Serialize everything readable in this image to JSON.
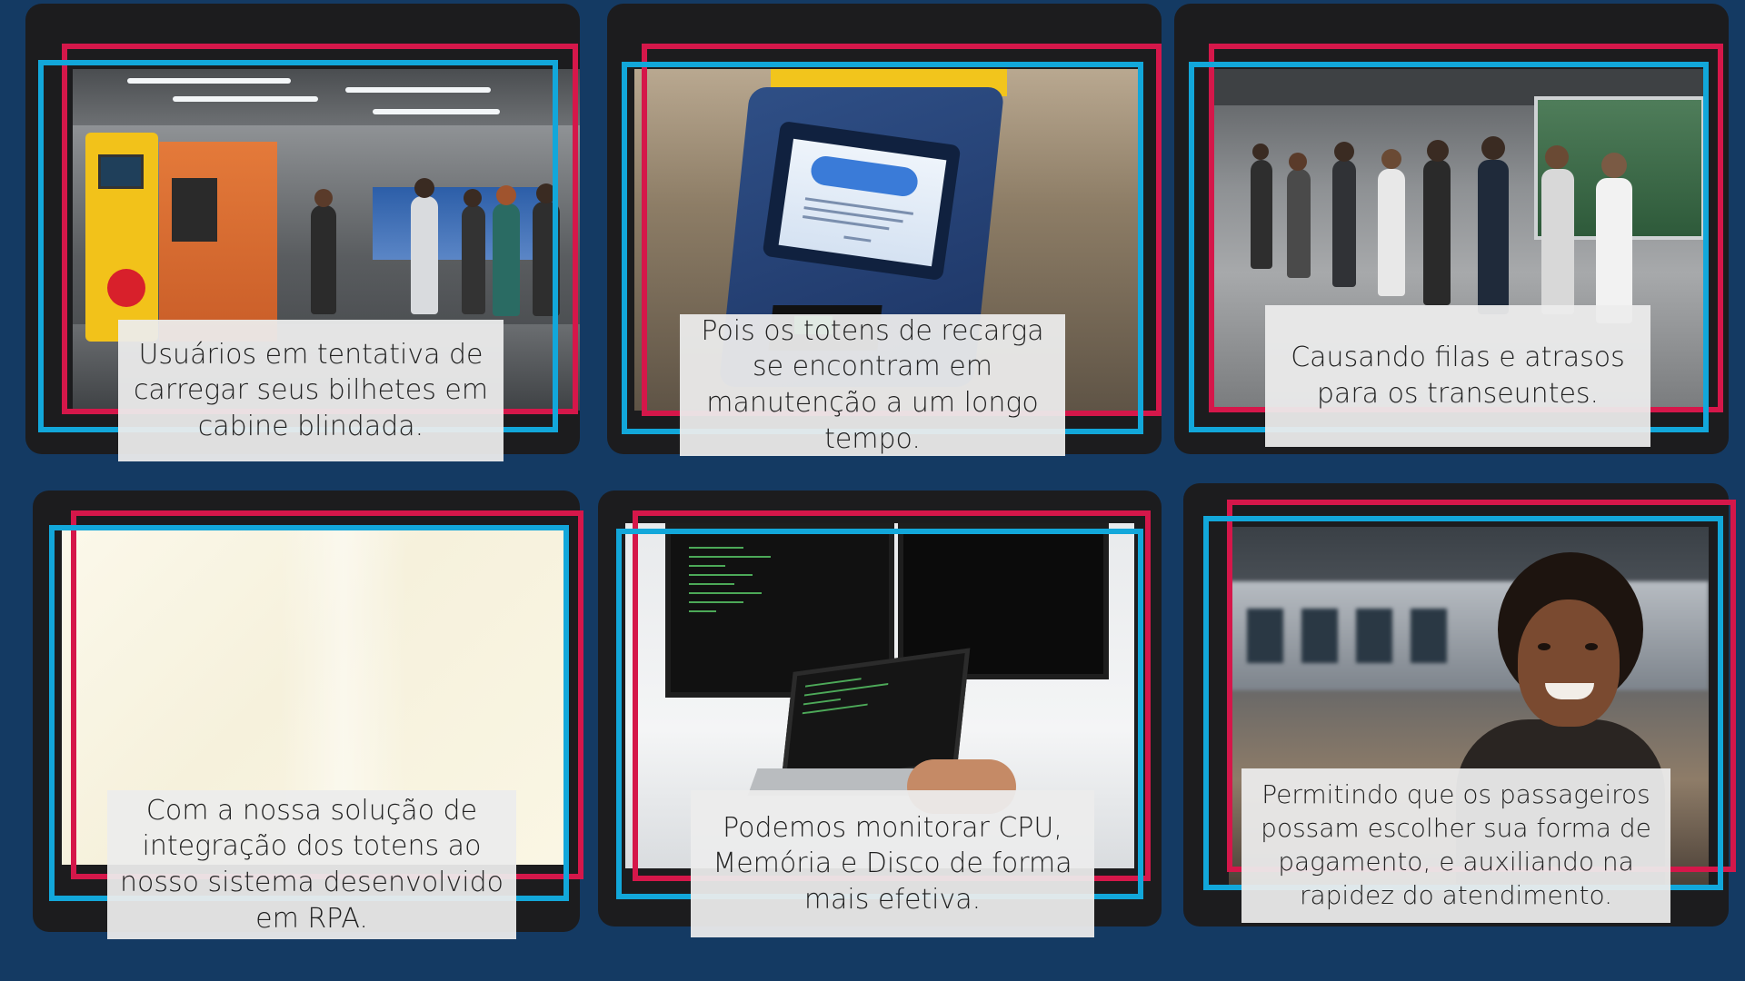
{
  "background_color": "#143a63",
  "accent_colors": {
    "red": "#d5174a",
    "blue": "#12a7da",
    "card": "#1c1c1e"
  },
  "cards": [
    {
      "caption": "Usuários em tentativa de carregar seus bilhetes em cabine blindada.",
      "image": "station-ticket-machines-photo"
    },
    {
      "caption": "Pois os totens de recarga se encontram em manutenção a um longo tempo.",
      "image": "kiosk-out-of-service-photo"
    },
    {
      "caption": "Causando filas e atrasos para os transeuntes.",
      "image": "crowded-station-queue-photo"
    },
    {
      "caption": "Com a nossa solução de integração dos totens ao nosso sistema desenvolvido em RPA.",
      "image": "blank-cream-panel"
    },
    {
      "caption": "Podemos monitorar CPU, Memória e Disco de forma mais efetiva.",
      "image": "monitors-with-code-photo"
    },
    {
      "caption": "Permitindo que os passageiros possam escolher sua forma de pagamento, e auxiliando na rapidez do atendimento.",
      "image": "smiling-passenger-photo"
    }
  ]
}
